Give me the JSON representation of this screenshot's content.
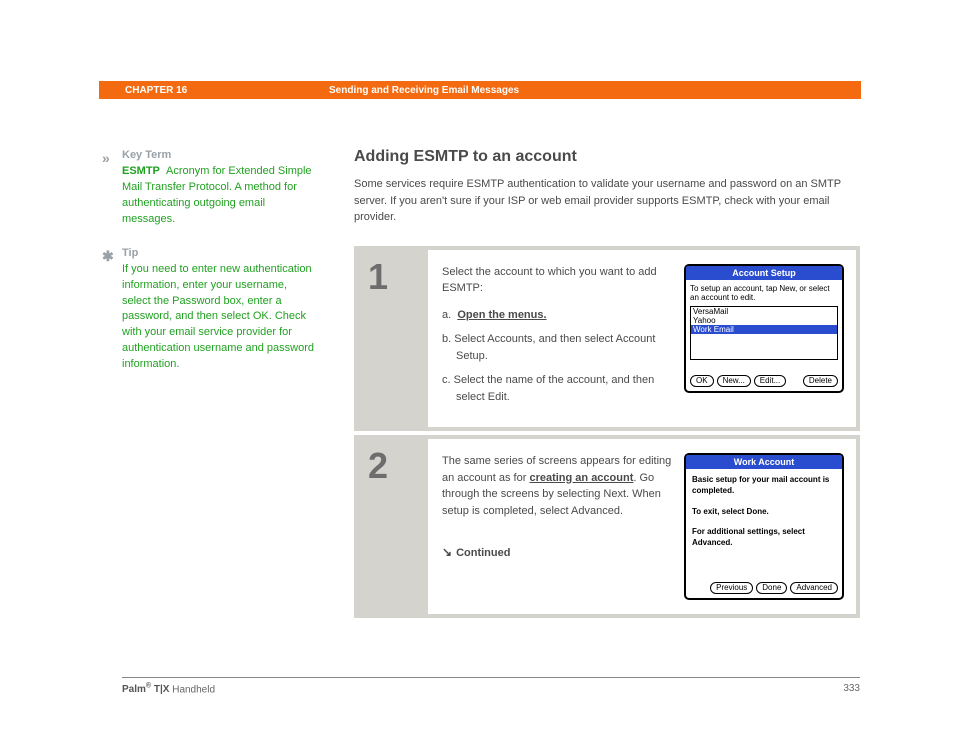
{
  "header": {
    "chapter": "CHAPTER 16",
    "title": "Sending and Receiving Email Messages"
  },
  "sidebar": {
    "keyterm": {
      "marker": "»",
      "heading": "Key Term",
      "term": "ESMTP",
      "definition": "Acronym for Extended Simple Mail Transfer Protocol. A method for authenticating outgoing email messages."
    },
    "tip": {
      "marker": "✱",
      "heading": "Tip",
      "body": "If you need to enter new authentication information, enter your username, select the Password box, enter a password, and then select OK. Check with your email service provider for authentication username and password information."
    }
  },
  "main": {
    "heading": "Adding ESMTP to an account",
    "intro": "Some services require ESMTP authentication to validate your username and password on an SMTP server. If you aren't sure if your ISP or web email provider supports ESMTP, check with your email provider."
  },
  "step1": {
    "num": "1",
    "lead": "Select the account to which you want to add ESMTP:",
    "a_label": "a.",
    "a_link": "Open the menus.",
    "b": "b.  Select Accounts, and then select Account Setup.",
    "c": "c.  Select the name of the account, and then select Edit.",
    "screen": {
      "title": "Account Setup",
      "hint": "To setup an account, tap New, or select an account to edit.",
      "items": {
        "0": "VersaMail",
        "1": "Yahoo",
        "2": "Work Email"
      },
      "buttons": {
        "ok": "OK",
        "new": "New...",
        "edit": "Edit...",
        "delete": "Delete"
      }
    }
  },
  "step2": {
    "num": "2",
    "body_pre": "The same series of screens appears for editing an account as for ",
    "body_link": "creating an account",
    "body_post": ". Go through the screens by selecting Next. When setup is completed, select Advanced.",
    "continued": "Continued",
    "screen": {
      "title": "Work Account",
      "l1": "Basic setup for your mail account is completed.",
      "l2": "To exit, select Done.",
      "l3": "For additional settings, select Advanced.",
      "buttons": {
        "prev": "Previous",
        "done": "Done",
        "adv": "Advanced"
      }
    }
  },
  "footer": {
    "product_bold": "Palm",
    "reg": "®",
    "product_rest": " T|X",
    "product_tail": " Handheld",
    "page": "333"
  }
}
